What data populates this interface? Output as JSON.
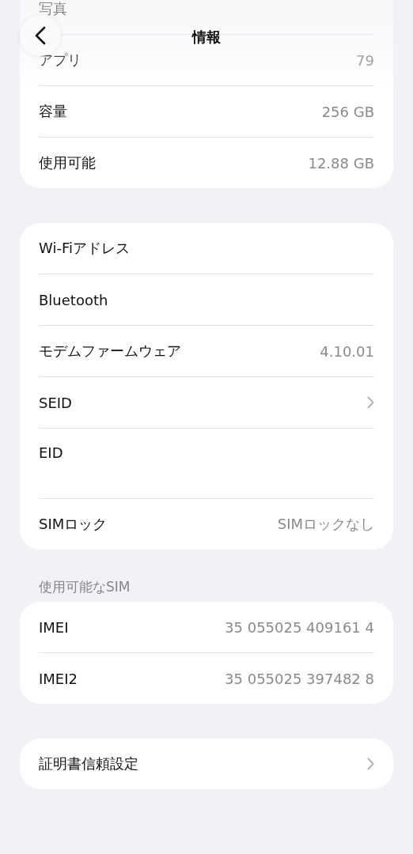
{
  "navigation": {
    "title": "情報"
  },
  "sections": [
    {
      "rows": [
        {
          "label": "写真"
        },
        {
          "label": "アプリ",
          "value": "79"
        },
        {
          "label": "容量",
          "value": "256 GB"
        },
        {
          "label": "使用可能",
          "value": "12.88 GB"
        }
      ]
    },
    {
      "rows": [
        {
          "label": "Wi-Fiアドレス"
        },
        {
          "label": "Bluetooth"
        },
        {
          "label": "モデムファームウェア",
          "value": "4.10.01"
        },
        {
          "label": "SEID",
          "chevron": true
        },
        {
          "label": "EID",
          "tall": true
        },
        {
          "label": "SIMロック",
          "value": "SIMロックなし"
        }
      ]
    },
    {
      "header": "使用可能なSIM",
      "rows": [
        {
          "label": "IMEI",
          "value": "35 055025 409161 4"
        },
        {
          "label": "IMEI2",
          "value": "35 055025 397482 8"
        }
      ]
    },
    {
      "rows": [
        {
          "label": "証明書信頼設定",
          "chevron": true
        }
      ]
    }
  ]
}
